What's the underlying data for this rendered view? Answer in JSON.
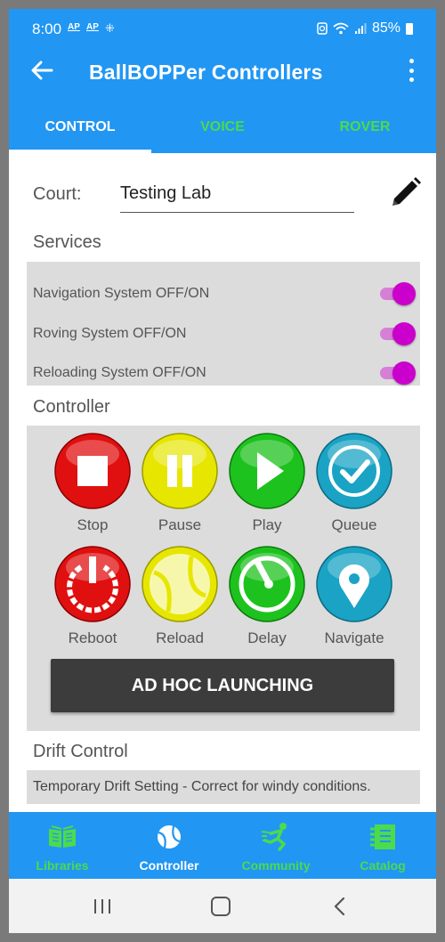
{
  "status_bar": {
    "time": "8:00",
    "ap1": "AP",
    "ap2": "AP",
    "battery": "85%"
  },
  "app_bar": {
    "title": "BallBOPPer Controllers"
  },
  "tabs": [
    {
      "label": "CONTROL",
      "active": true
    },
    {
      "label": "VOICE",
      "active": false
    },
    {
      "label": "ROVER",
      "active": false
    }
  ],
  "court": {
    "label": "Court:",
    "value": "Testing Lab"
  },
  "services": {
    "title": "Services",
    "items": [
      {
        "label": "Navigation System OFF/ON",
        "on": true
      },
      {
        "label": "Roving System OFF/ON",
        "on": true
      },
      {
        "label": "Reloading System OFF/ON",
        "on": true
      }
    ]
  },
  "controller": {
    "title": "Controller",
    "buttons": [
      {
        "label": "Stop",
        "icon": "stop-icon",
        "color": "#e01010"
      },
      {
        "label": "Pause",
        "icon": "pause-icon",
        "color": "#e6e600"
      },
      {
        "label": "Play",
        "icon": "play-icon",
        "color": "#1ec21e"
      },
      {
        "label": "Queue",
        "icon": "check-icon",
        "color": "#1aa3c4"
      },
      {
        "label": "Reboot",
        "icon": "power-icon",
        "color": "#e01010"
      },
      {
        "label": "Reload",
        "icon": "tennis-ball-icon",
        "color": "#e6e600"
      },
      {
        "label": "Delay",
        "icon": "timer-icon",
        "color": "#1ec21e"
      },
      {
        "label": "Navigate",
        "icon": "location-pin-icon",
        "color": "#1aa3c4"
      }
    ],
    "adhoc_label": "AD HOC LAUNCHING"
  },
  "drift": {
    "title": "Drift Control",
    "text": "Temporary Drift Setting - Correct for windy conditions."
  },
  "bottom_nav": [
    {
      "label": "Libraries",
      "icon": "book-icon",
      "active": false
    },
    {
      "label": "Controller",
      "icon": "tennis-ball-icon",
      "active": true
    },
    {
      "label": "Community",
      "icon": "runner-icon",
      "active": false
    },
    {
      "label": "Catalog",
      "icon": "catalog-icon",
      "active": false
    }
  ],
  "colors": {
    "primary": "#2196f3",
    "accent_green": "#4cdb4c",
    "toggle": "#cc00cc",
    "panel": "#dcdcdc"
  }
}
